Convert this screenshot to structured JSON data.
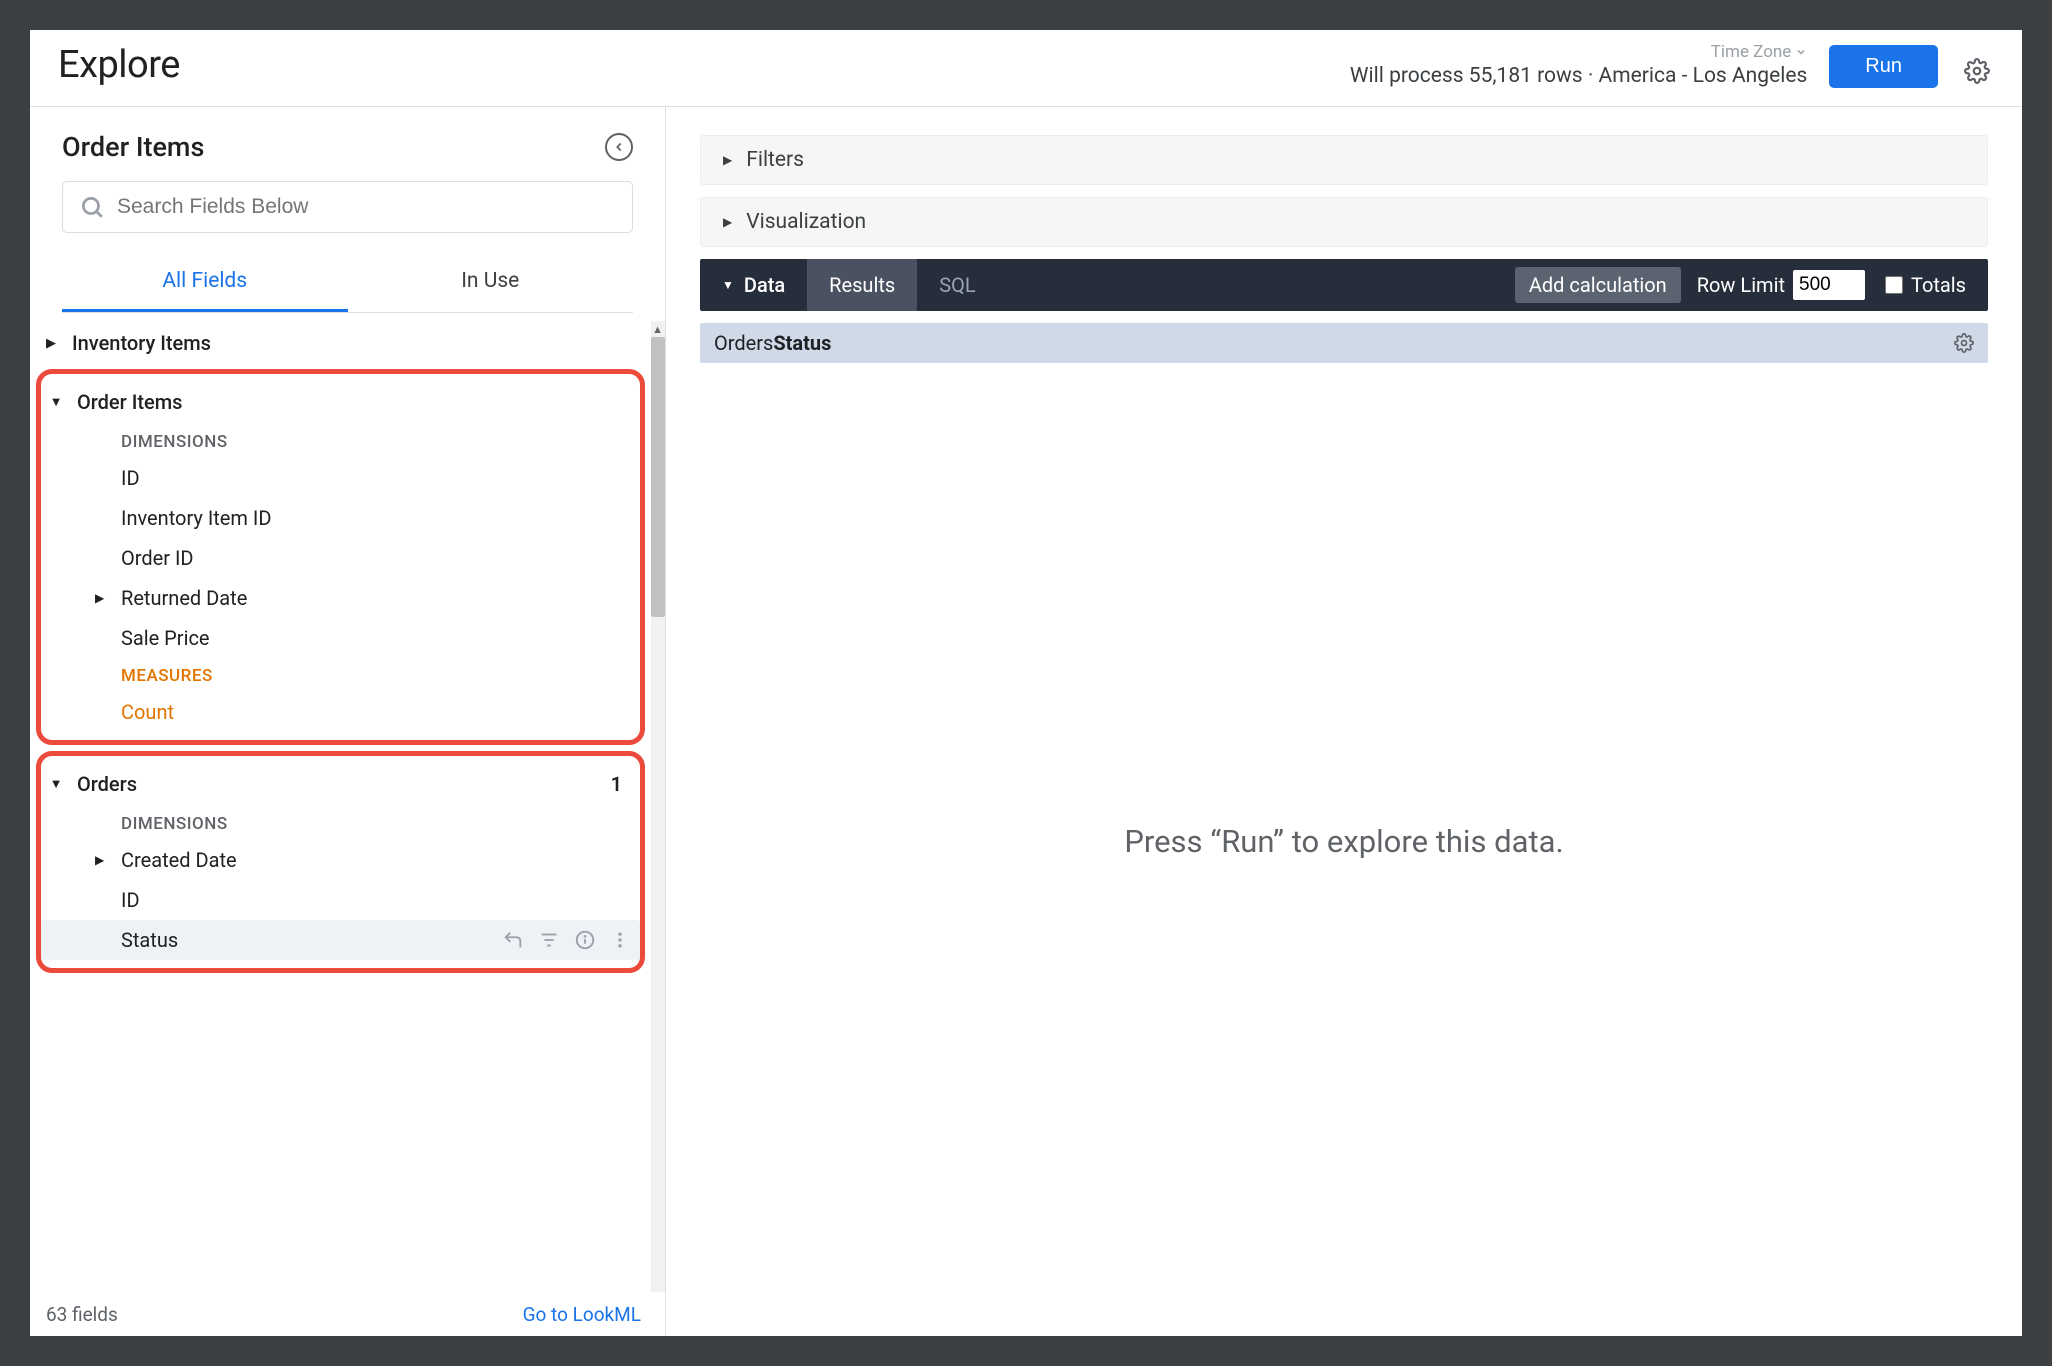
{
  "header": {
    "title": "Explore",
    "timezone_label": "Time Zone",
    "rows_line": "Will process 55,181 rows · America - Los Angeles",
    "run_label": "Run"
  },
  "sidebar": {
    "title": "Order Items",
    "search_placeholder": "Search Fields Below",
    "tabs": {
      "all": "All Fields",
      "in_use": "In Use"
    },
    "views": {
      "inventory_items": "Inventory Items",
      "order_items": {
        "label": "Order Items",
        "dimensions_label": "DIMENSIONS",
        "dims": {
          "id": "ID",
          "inventory_item_id": "Inventory Item ID",
          "order_id": "Order ID",
          "returned_date": "Returned Date",
          "sale_price": "Sale Price"
        },
        "measures_label": "MEASURES",
        "measures": {
          "count": "Count"
        }
      },
      "orders": {
        "label": "Orders",
        "badge": "1",
        "dimensions_label": "DIMENSIONS",
        "dims": {
          "created_date": "Created Date",
          "id": "ID",
          "status": "Status"
        }
      }
    },
    "footer": {
      "count": "63 fields",
      "link": "Go to LookML"
    }
  },
  "main": {
    "filters_label": "Filters",
    "viz_label": "Visualization",
    "data": {
      "label": "Data",
      "results": "Results",
      "sql": "SQL",
      "add_calc": "Add calculation",
      "row_limit_label": "Row Limit",
      "row_limit_value": "500",
      "totals_label": "Totals"
    },
    "column_header": {
      "view": "Orders ",
      "field": "Status"
    },
    "hint": "Press “Run” to explore this data."
  }
}
